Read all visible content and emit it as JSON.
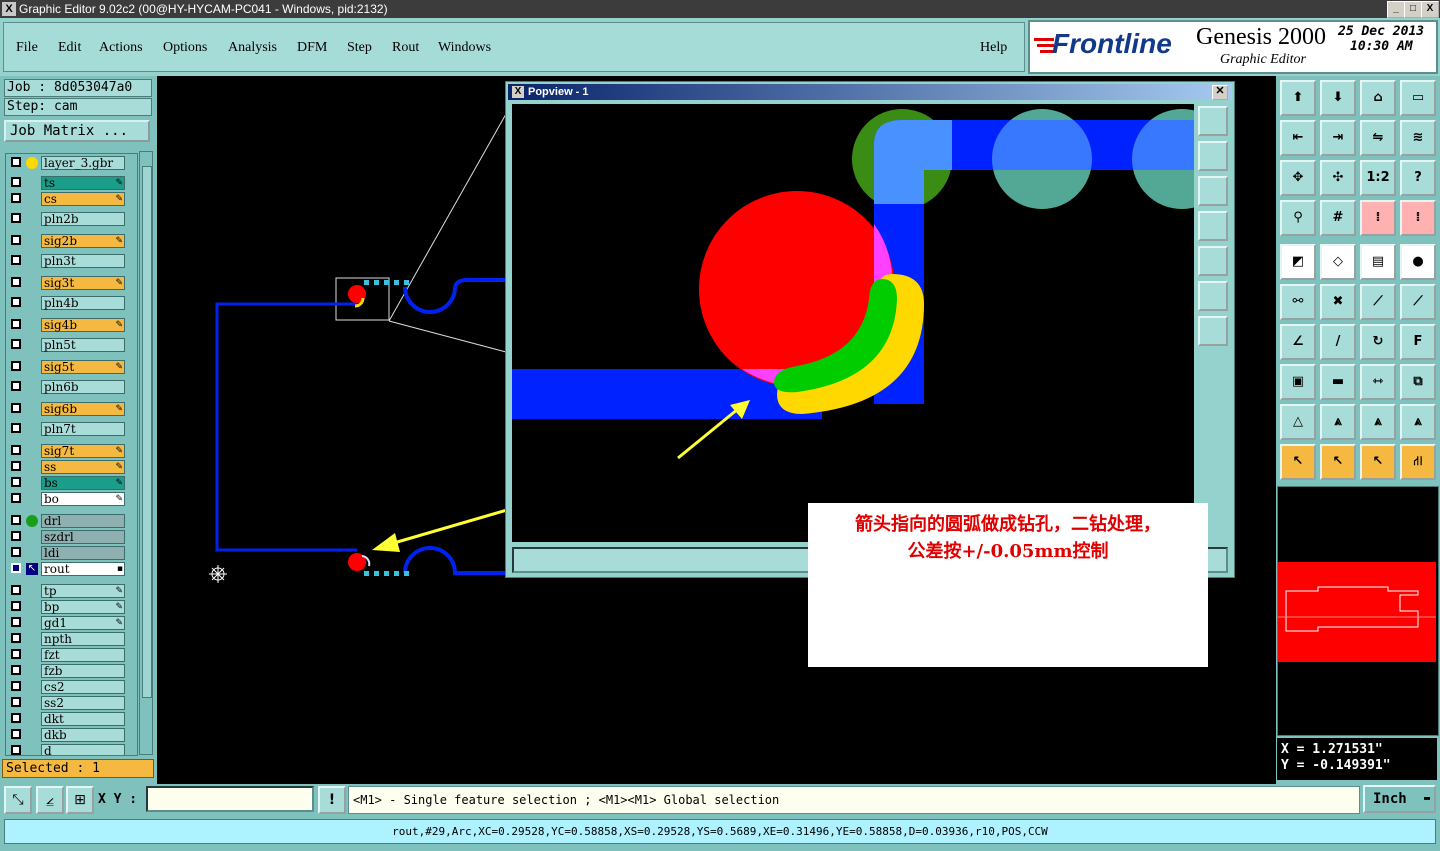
{
  "window": {
    "title": "Graphic Editor 9.02c2 (00@HY-HYCAM-PC041 - Windows, pid:2132)",
    "buttons": [
      "_",
      "□",
      "X"
    ]
  },
  "menu": {
    "items": [
      "File",
      "Edit",
      "Actions",
      "Options",
      "Analysis",
      "DFM",
      "Step",
      "Rout",
      "Windows"
    ],
    "help": "Help"
  },
  "brand": {
    "logo": "Frontline",
    "product": "Genesis 2000",
    "subtitle": "Graphic Editor",
    "date": "25 Dec 2013",
    "time": "10:30 AM"
  },
  "job": {
    "job_label": "Job : 8d053047a0",
    "step_label": "Step: cam",
    "job_matrix": "Job Matrix ..."
  },
  "layers": [
    {
      "name": "layer_3.gbr",
      "color": "#a8dcd8",
      "dot": "#ffd800",
      "flag": ""
    },
    {
      "name": "ts",
      "color": "#1a9e8a",
      "dot": "",
      "flag": "✎"
    },
    {
      "name": "cs",
      "color": "#f5b942",
      "dot": "",
      "flag": "✎"
    },
    {
      "name": "pln2b",
      "color": "#a8dcd8",
      "dot": "",
      "flag": ""
    },
    {
      "name": "sig2b",
      "color": "#f5b942",
      "dot": "",
      "flag": "✎"
    },
    {
      "name": "pln3t",
      "color": "#a8dcd8",
      "dot": "",
      "flag": ""
    },
    {
      "name": "sig3t",
      "color": "#f5b942",
      "dot": "",
      "flag": "✎"
    },
    {
      "name": "pln4b",
      "color": "#a8dcd8",
      "dot": "",
      "flag": ""
    },
    {
      "name": "sig4b",
      "color": "#f5b942",
      "dot": "",
      "flag": "✎"
    },
    {
      "name": "pln5t",
      "color": "#a8dcd8",
      "dot": "",
      "flag": ""
    },
    {
      "name": "sig5t",
      "color": "#f5b942",
      "dot": "",
      "flag": "✎"
    },
    {
      "name": "pln6b",
      "color": "#a8dcd8",
      "dot": "",
      "flag": ""
    },
    {
      "name": "sig6b",
      "color": "#f5b942",
      "dot": "",
      "flag": "✎"
    },
    {
      "name": "pln7t",
      "color": "#a8dcd8",
      "dot": "",
      "flag": ""
    },
    {
      "name": "sig7t",
      "color": "#f5b942",
      "dot": "",
      "flag": "✎"
    },
    {
      "name": "ss",
      "color": "#f5b942",
      "dot": "",
      "flag": "✎"
    },
    {
      "name": "bs",
      "color": "#1a9e8a",
      "dot": "",
      "flag": "✎"
    },
    {
      "name": "bo",
      "color": "#ffffff",
      "dot": "",
      "flag": "✎"
    },
    {
      "name": "drl",
      "color": "#8fb0b0",
      "dot": "#1a9e1a",
      "flag": ""
    },
    {
      "name": "szdrl",
      "color": "#8fb0b0",
      "dot": "",
      "flag": ""
    },
    {
      "name": "ldi",
      "color": "#8fb0b0",
      "dot": "",
      "flag": ""
    },
    {
      "name": "rout",
      "color": "#ffffff",
      "dot": "",
      "flag": "▪"
    },
    {
      "name": "tp",
      "color": "#a8dcd8",
      "dot": "",
      "flag": "✎"
    },
    {
      "name": "bp",
      "color": "#a8dcd8",
      "dot": "",
      "flag": "✎"
    },
    {
      "name": "gd1",
      "color": "#a8dcd8",
      "dot": "",
      "flag": "✎"
    },
    {
      "name": "npth",
      "color": "#a8dcd8",
      "dot": "",
      "flag": ""
    },
    {
      "name": "fzt",
      "color": "#a8dcd8",
      "dot": "",
      "flag": ""
    },
    {
      "name": "fzb",
      "color": "#a8dcd8",
      "dot": "",
      "flag": ""
    },
    {
      "name": "cs2",
      "color": "#a8dcd8",
      "dot": "",
      "flag": ""
    },
    {
      "name": "ss2",
      "color": "#a8dcd8",
      "dot": "",
      "flag": ""
    },
    {
      "name": "dkt",
      "color": "#a8dcd8",
      "dot": "",
      "flag": ""
    },
    {
      "name": "dkb",
      "color": "#a8dcd8",
      "dot": "",
      "flag": ""
    },
    {
      "name": "d",
      "color": "#a8dcd8",
      "dot": "",
      "flag": ""
    }
  ],
  "selected": "Selected : 1",
  "popview": {
    "title": "Popview - 1"
  },
  "annotation": {
    "line1": "箭头指向的圆弧做成钻孔，二钻处理，",
    "line2": "公差按+/-0.05mm控制"
  },
  "toolbox": {
    "ratio_label": "1:2",
    "help_label": "?"
  },
  "coords": {
    "x": "X  = 1.271531\"",
    "y": "Y  = -0.149391\""
  },
  "bottom": {
    "xy_label": "X Y :",
    "xy_value": "",
    "alert": "!",
    "message": "<M1> - Single feature selection ; <M1><M1> Global selection",
    "unit": "Inch",
    "status": "rout,#29,Arc,XC=0.29528,YC=0.58858,XS=0.29528,YS=0.5689,XE=0.31496,YE=0.58858,D=0.03936,r10,POS,CCW"
  }
}
